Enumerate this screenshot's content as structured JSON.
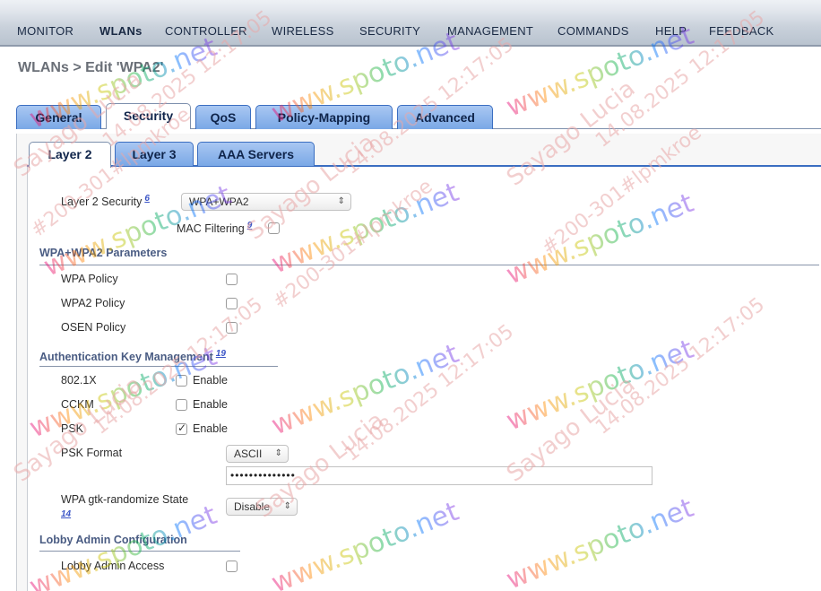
{
  "nav": {
    "items": [
      "MONITOR",
      "WLANs",
      "CONTROLLER",
      "WIRELESS",
      "SECURITY",
      "MANAGEMENT",
      "COMMANDS",
      "HELP",
      "FEEDBACK"
    ]
  },
  "page_title": "WLANs > Edit  'WPA2'",
  "tabs_main": [
    "General",
    "Security",
    "QoS",
    "Policy-Mapping",
    "Advanced"
  ],
  "tabs_main_active": "Security",
  "tabs_sub": [
    "Layer 2",
    "Layer 3",
    "AAA Servers"
  ],
  "tabs_sub_active": "Layer 2",
  "layer2": {
    "security_label": "Layer 2 Security",
    "security_footnote": "6",
    "security_value": "WPA+WPA2",
    "mac_filtering_label": "MAC Filtering",
    "mac_filtering_footnote": "9",
    "mac_filtering_checked": false
  },
  "wpa_section": {
    "title": "WPA+WPA2 Parameters",
    "rows": [
      {
        "label": "WPA Policy",
        "checked": false
      },
      {
        "label": "WPA2 Policy",
        "checked": false
      },
      {
        "label": "OSEN Policy",
        "checked": false
      }
    ]
  },
  "akm_section": {
    "title": "Authentication Key Management",
    "footnote": "19",
    "rows": [
      {
        "label": "802.1X",
        "option": "Enable",
        "checked": false
      },
      {
        "label": "CCKM",
        "option": "Enable",
        "checked": false
      },
      {
        "label": "PSK",
        "option": "Enable",
        "checked": true
      }
    ],
    "psk_format_label": "PSK Format",
    "psk_format_value": "ASCII",
    "psk_value": "••••••••••••••",
    "gtk_label": "WPA gtk-randomize State",
    "gtk_footnote": "14",
    "gtk_value": "Disable"
  },
  "lobby_section": {
    "title": "Lobby Admin Configuration",
    "access_label": "Lobby Admin Access",
    "access_checked": false
  },
  "watermark": {
    "site": "www.spoto.net",
    "line1": "Sayago Lucia",
    "line2": "#200-301#lpmkroe",
    "line3": "14.08.2025 12:17:05"
  }
}
